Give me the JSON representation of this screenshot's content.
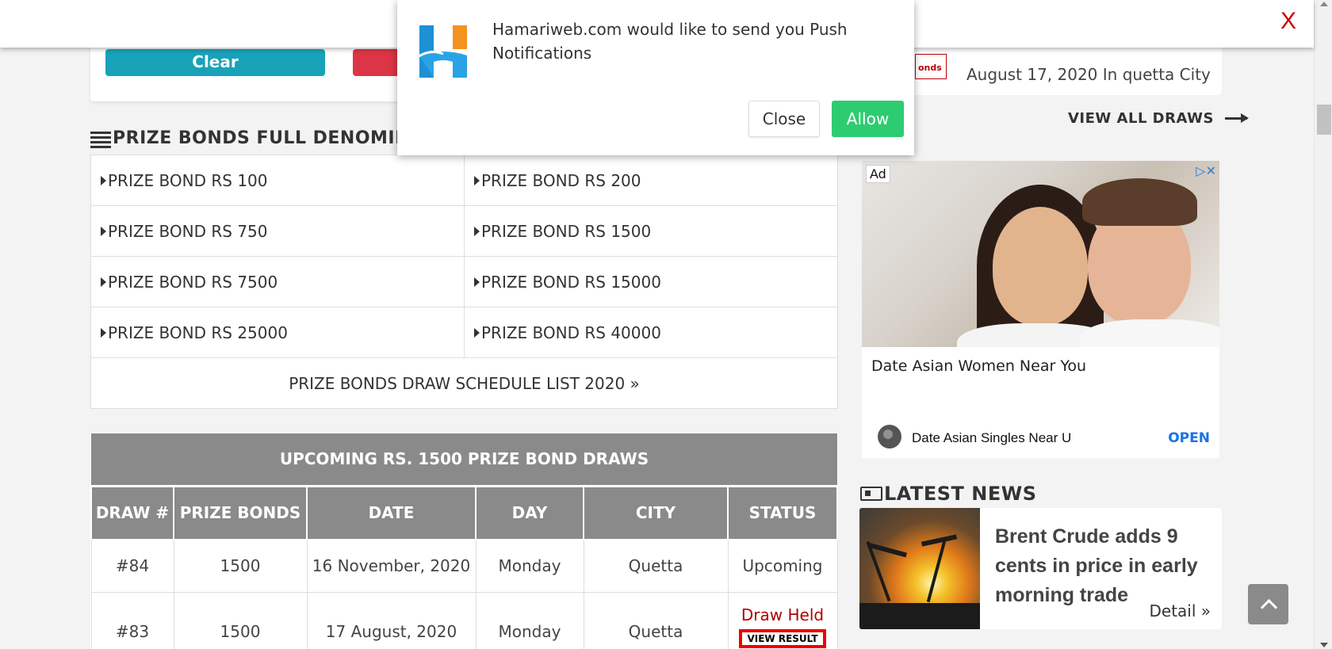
{
  "banner": {
    "close_label": "X"
  },
  "top_card": {
    "clear_label": "Clear"
  },
  "section": {
    "title": "PRIZE BONDS FULL DENOMINA"
  },
  "denominations": [
    "PRIZE BOND RS 100",
    "PRIZE BOND RS 200",
    "PRIZE BOND RS 750",
    "PRIZE BOND RS 1500",
    "PRIZE BOND RS 7500",
    "PRIZE BOND RS 15000",
    "PRIZE BOND RS 25000",
    "PRIZE BOND RS 40000"
  ],
  "schedule_link": "PRIZE BONDS DRAW SCHEDULE LIST 2020 »",
  "draws": {
    "caption": "UPCOMING RS. 1500 PRIZE BOND DRAWS",
    "headers": [
      "DRAW #",
      "PRIZE BONDS",
      "DATE",
      "DAY",
      "CITY",
      "STATUS"
    ],
    "rows": [
      {
        "draw": "#84",
        "bonds": "1500",
        "date": "16 November, 2020",
        "day": "Monday",
        "city": "Quetta",
        "status": "Upcoming"
      },
      {
        "draw": "#83",
        "bonds": "1500",
        "date": "17 August, 2020",
        "day": "Monday",
        "city": "Quetta",
        "status": "Draw Held",
        "action": "VIEW RESULT"
      }
    ]
  },
  "right": {
    "draw_card_thumb": "onds",
    "draw_card_text": "August 17, 2020 In quetta City",
    "view_all": "VIEW ALL DRAWS"
  },
  "ad": {
    "badge": "Ad",
    "choices": "▷✕",
    "title": "Date Asian Women Near You",
    "advertiser": "Date Asian Singles Near U",
    "cta": "OPEN"
  },
  "news": {
    "heading": "LATEST NEWS",
    "title": "Brent Crude adds 9 cents in price in early morning trade",
    "detail": "Detail »"
  },
  "notification": {
    "text": "Hamariweb.com would like to send you Push Notifications",
    "close_label": "Close",
    "allow_label": "Allow"
  },
  "colors": {
    "teal": "#17a2b8",
    "red": "#dc3545",
    "header_gray": "#8a8a8a",
    "link_blue": "#1a8ad6",
    "upcoming_green": "#1e9e1e",
    "held_red": "#b00000",
    "allow_green": "#2ecc71"
  }
}
